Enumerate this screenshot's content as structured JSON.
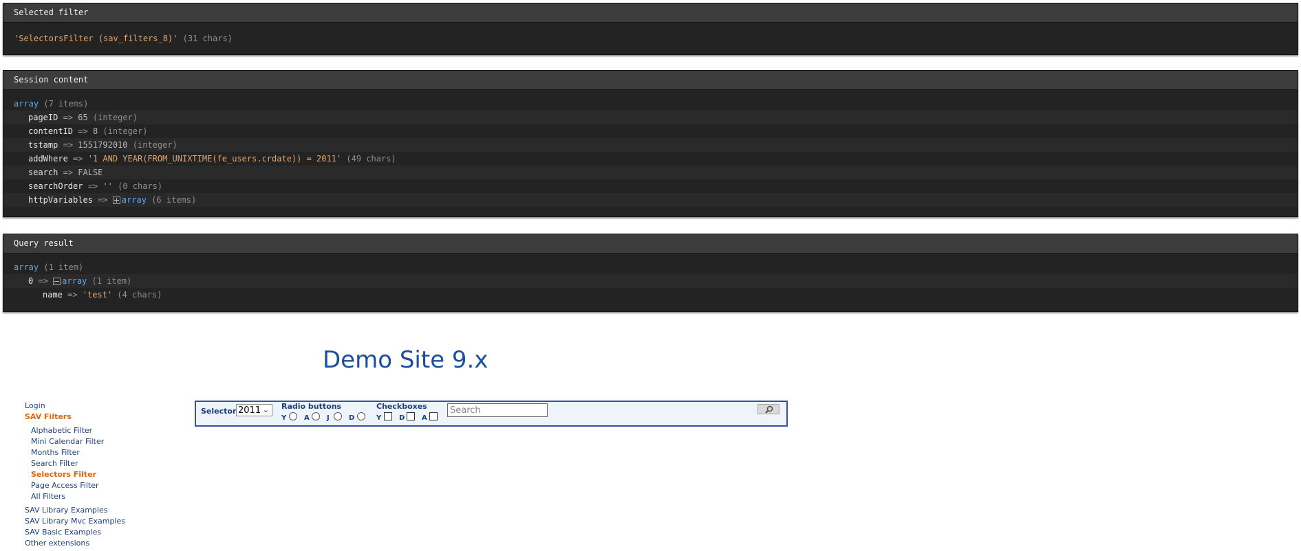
{
  "selected_filter": {
    "title": "Selected filter",
    "value": "'SelectorsFilter (sav_filters_8)'",
    "meta": "(31 chars)"
  },
  "session": {
    "title": "Session content",
    "root_type": "array",
    "root_meta": "(7 items)",
    "rows": [
      {
        "key": "pageID",
        "value": "65",
        "meta": "(integer)"
      },
      {
        "key": "contentID",
        "value": "8",
        "meta": "(integer)"
      },
      {
        "key": "tstamp",
        "value": "1551792010",
        "meta": "(integer)"
      },
      {
        "key": "addWhere",
        "value": "'1 AND YEAR(FROM_UNIXTIME(fe_users.crdate)) = 2011'",
        "meta": "(49 chars)"
      },
      {
        "key": "search",
        "value": "FALSE",
        "meta": ""
      },
      {
        "key": "searchOrder",
        "value": "''",
        "meta": "(0 chars)"
      },
      {
        "key": "httpVariables",
        "value": "array",
        "meta": "(6 items)"
      }
    ],
    "arrow": "=>"
  },
  "query": {
    "title": "Query result",
    "root_type": "array",
    "root_meta": "(1 item)",
    "row1": {
      "key": "0",
      "value": "array",
      "meta": "(1 item)"
    },
    "row2": {
      "key": "name",
      "value": "'test'",
      "meta": "(4 chars)"
    },
    "arrow": "=>"
  },
  "site": {
    "title": "Demo Site 9.x",
    "menu": [
      {
        "label": "Login"
      },
      {
        "label": "SAV Filters",
        "active": true
      },
      {
        "label": "Alphabetic Filter"
      },
      {
        "label": "Mini Calendar Filter"
      },
      {
        "label": "Months Filter"
      },
      {
        "label": "Search Filter"
      },
      {
        "label": "Selectors Filter",
        "active": true
      },
      {
        "label": "Page Access Filter"
      },
      {
        "label": "All Filters"
      },
      {
        "label": "SAV Library Examples"
      },
      {
        "label": "SAV Library Mvc Examples"
      },
      {
        "label": "SAV Basic Examples"
      },
      {
        "label": "Other extensions"
      }
    ]
  },
  "filter_form": {
    "selector_label": "Selector",
    "selector_value": "2011",
    "radio_label": "Radio buttons",
    "radio_options": [
      "Y",
      "A",
      "J",
      "D"
    ],
    "checkbox_label": "Checkboxes",
    "checkbox_options": [
      "Y",
      "D",
      "A"
    ],
    "search_placeholder": "Search",
    "search_icon": "magnifier-icon"
  },
  "colors": {
    "panel_bg": "#232323",
    "string": "#e5a66a",
    "array": "#5fa8e8",
    "link": "#1d3f7c",
    "active": "#e0650f",
    "site_title": "#1d4e9a"
  }
}
